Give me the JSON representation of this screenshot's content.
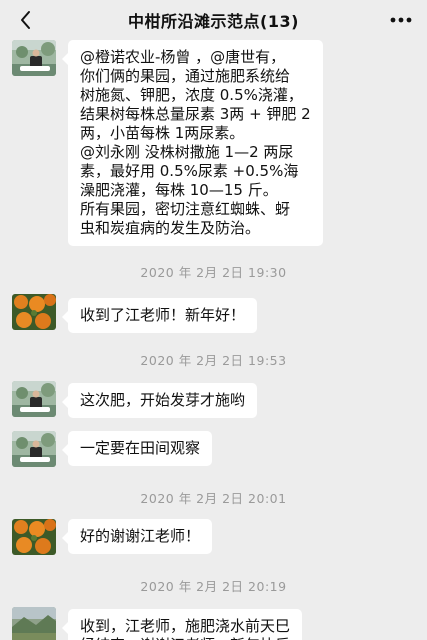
{
  "header": {
    "title": "中柑所沿滩示范点(13)"
  },
  "messages": [
    {
      "sender_avatar": "expert-avatar",
      "text": "@橙诺农业-杨曾 ，@唐世有，\n你们俩的果园，通过施肥系统给\n树施氮、钾肥，浓度 0.5%浇灌，\n结果树每株总量尿素 3两 + 钾肥 2\n两，小苗每株 1两尿素。\n@刘永刚  没株树撒施 1—2 两尿\n素，最好用 0.5%尿素 +0.5%海\n澡肥浇灌，每株 10—15 斤。\n所有果园，密切注意红蜘蛛、蚜\n虫和炭疽病的发生及防治。"
    },
    {
      "timestamp": "2020 年 2月 2日  19:30"
    },
    {
      "sender_avatar": "orange-avatar",
      "text": "收到了江老师！新年好！"
    },
    {
      "timestamp": "2020 年 2月 2日  19:53"
    },
    {
      "sender_avatar": "expert-avatar",
      "text": "这次肥，开始发芽才施哟"
    },
    {
      "sender_avatar": "expert-avatar",
      "text": "一定要在田间观察"
    },
    {
      "timestamp": "2020 年 2月 2日  20:01"
    },
    {
      "sender_avatar": "orange-avatar",
      "text": "好的谢谢江老师！"
    },
    {
      "timestamp": "2020 年 2月 2日  20:19"
    },
    {
      "sender_avatar": "landscape-avatar",
      "text": "收到，江老师，施肥浇水前天巳\n经结束，谢谢江老师，新年快乐"
    }
  ],
  "icons": {
    "back": "chevron-left-icon",
    "more": "more-dots-icon"
  },
  "colors": {
    "background": "#ededed",
    "bubble": "#ffffff",
    "timestamp_text": "#9a9a9a"
  }
}
